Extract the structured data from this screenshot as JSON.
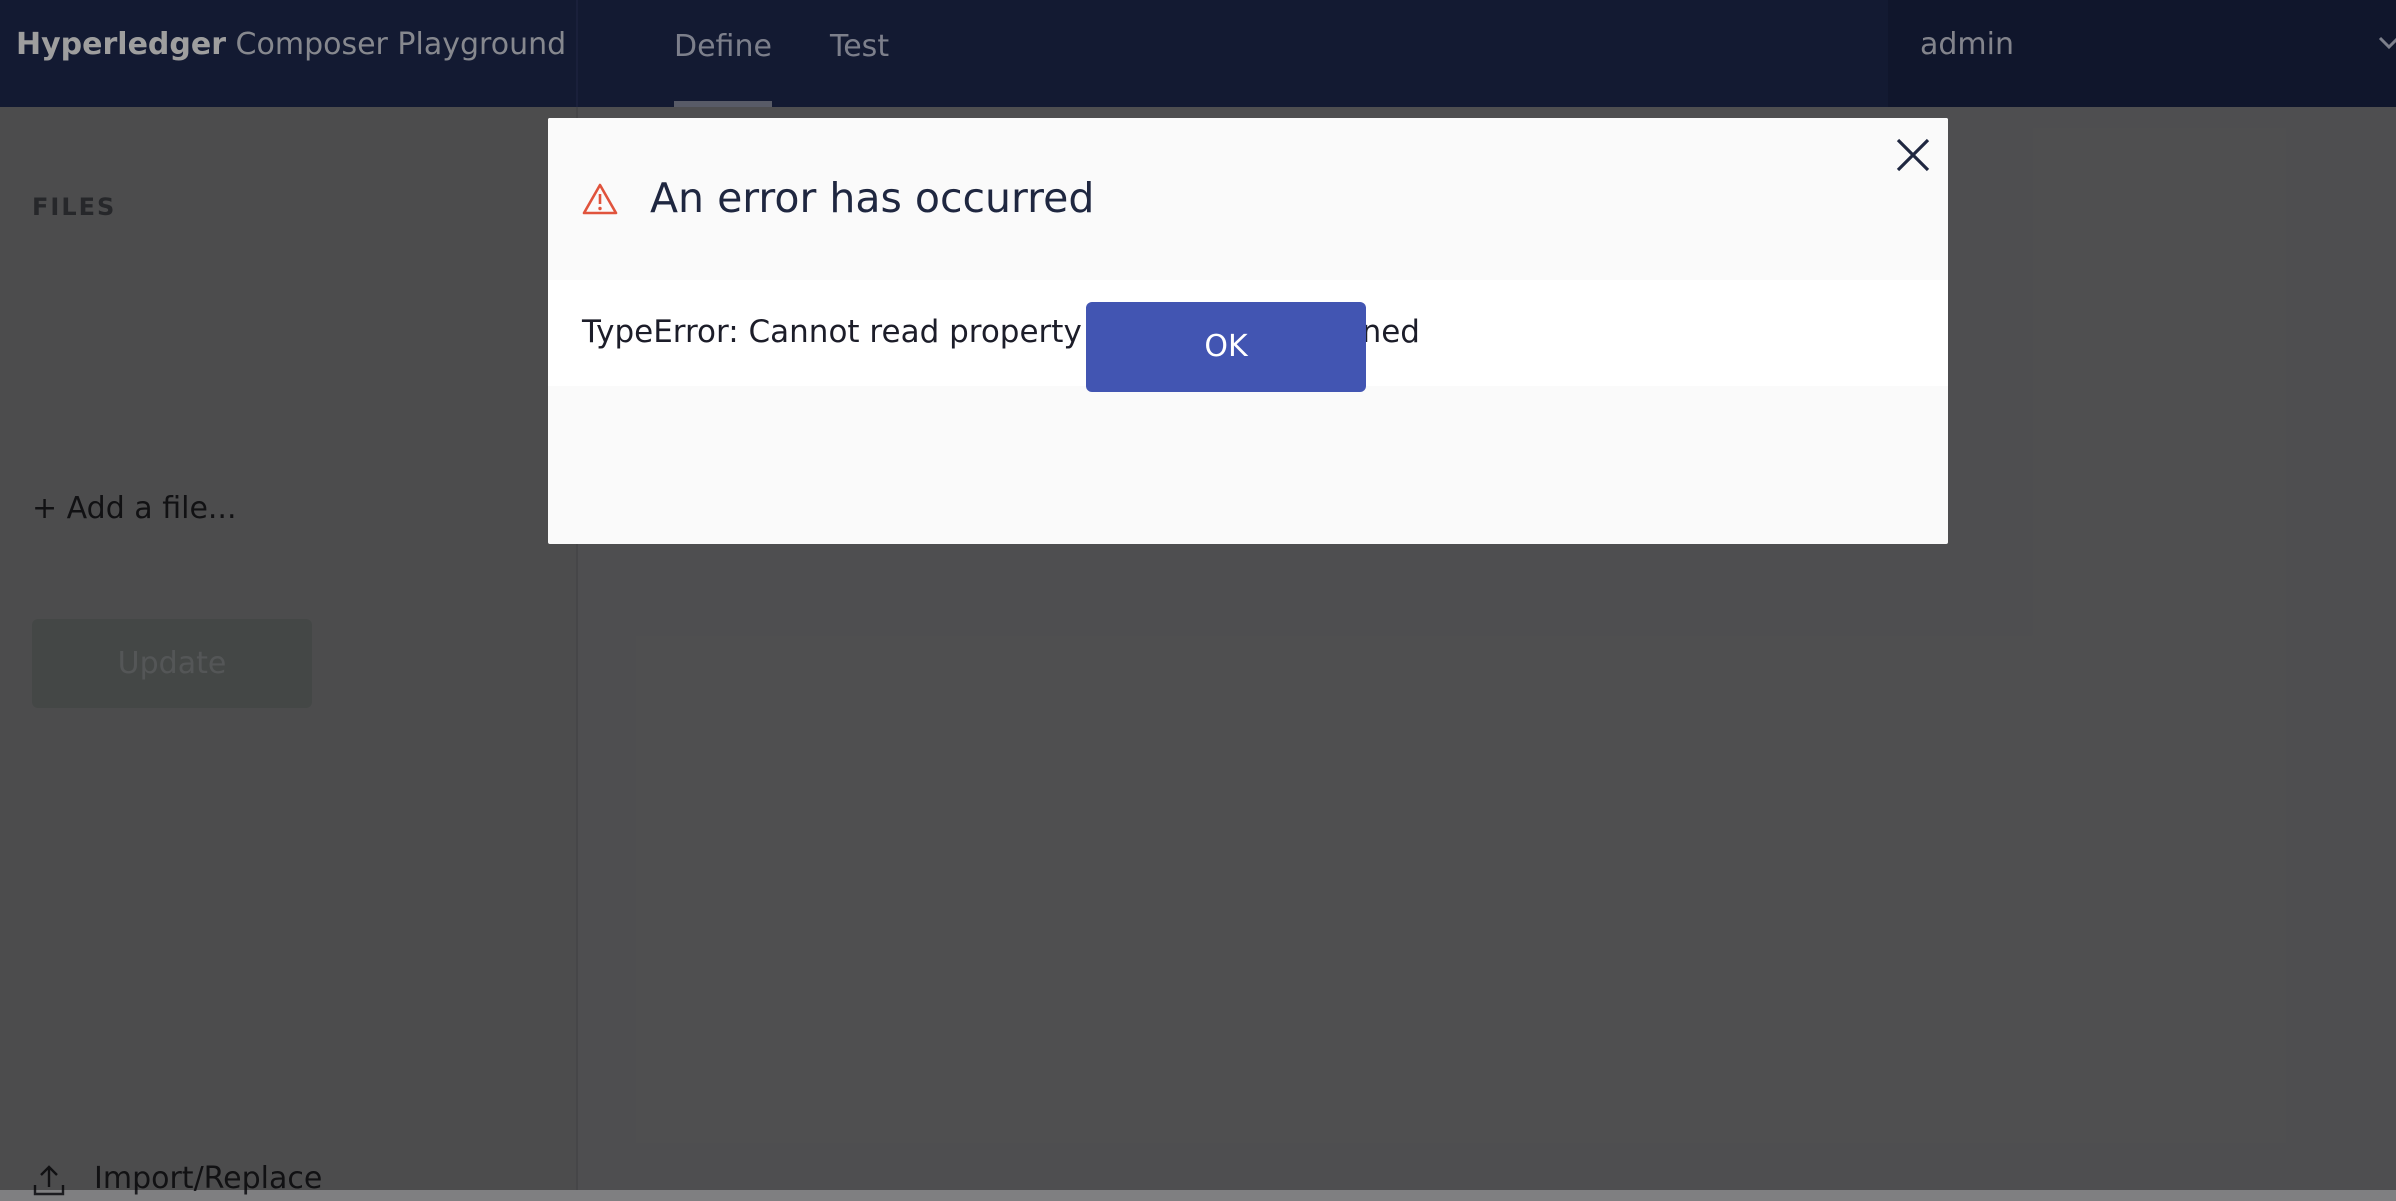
{
  "header": {
    "brand_strong": "Hyperledger",
    "brand_rest": "Composer Playground",
    "tabs": [
      {
        "label": "Define",
        "active": true
      },
      {
        "label": "Test",
        "active": false
      }
    ],
    "user": "admin"
  },
  "sidebar": {
    "files_title": "FILES",
    "add_file": "+ Add a file...",
    "update_label": "Update",
    "import_label": "Import/Replace"
  },
  "modal": {
    "title": "An error has occurred",
    "message": "TypeError: Cannot read property 'engine' of undefined",
    "ok_label": "OK"
  },
  "colors": {
    "header_bg": "#1f2a52",
    "primary_button": "#4255b2",
    "warning_icon": "#e0533c"
  },
  "icons": {
    "warning": "warning-triangle-icon",
    "close": "close-icon",
    "user_menu": "chevron-down-icon",
    "import": "upload-icon"
  }
}
